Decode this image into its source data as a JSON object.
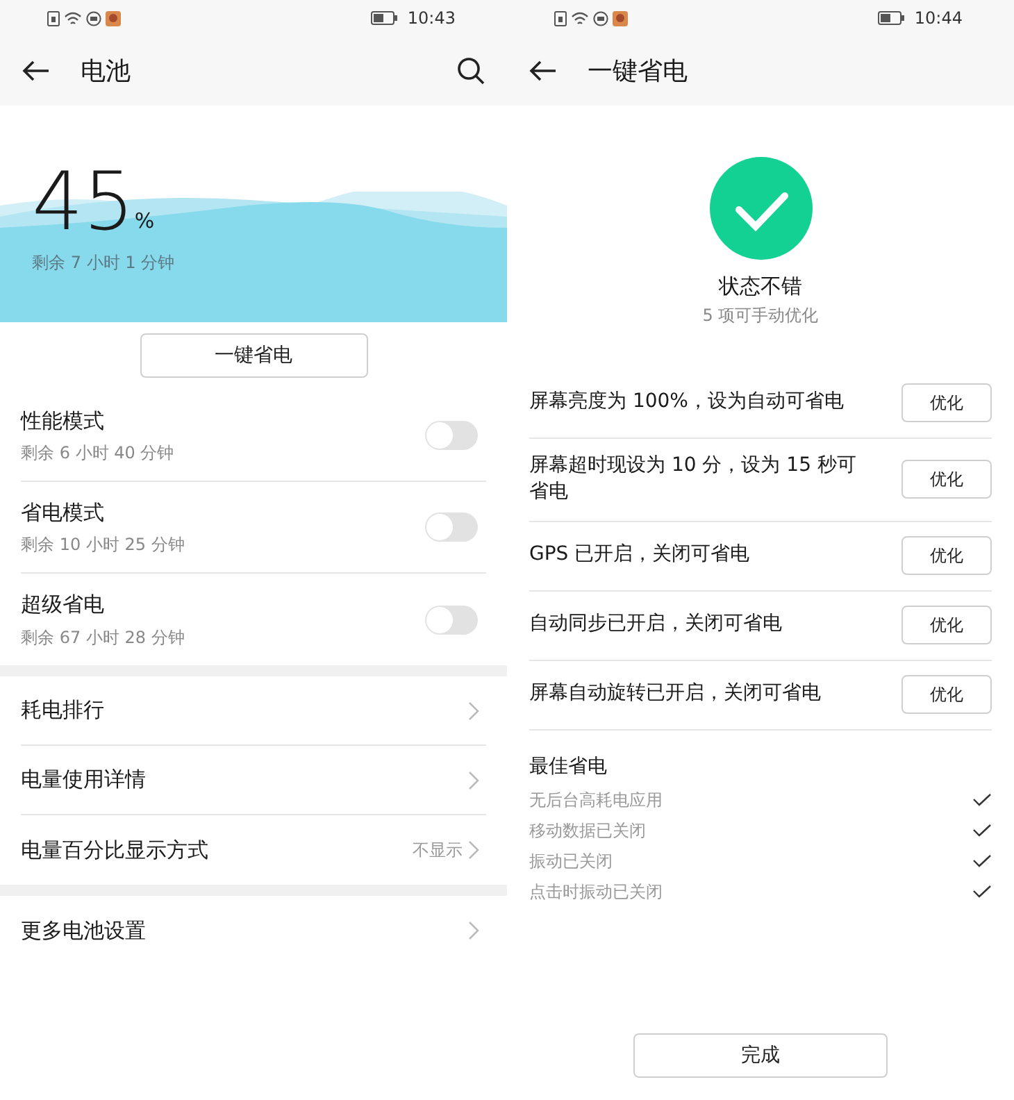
{
  "screens": [
    {
      "status_bar": {
        "time": "10:43"
      },
      "title": "电池",
      "has_search": true,
      "battery": {
        "percent": "45",
        "unit": "%",
        "remaining": "剩余 7 小时 1 分钟"
      },
      "save_button": "一键省电",
      "modes": [
        {
          "label": "性能模式",
          "sub": "剩余 6 小时 40 分钟",
          "on": false
        },
        {
          "label": "省电模式",
          "sub": "剩余 10 小时 25 分钟",
          "on": false
        },
        {
          "label": "超级省电",
          "sub": "剩余 67 小时 28 分钟",
          "on": false
        }
      ],
      "menu_groups": [
        [
          {
            "label": "耗电排行"
          },
          {
            "label": "电量使用详情"
          },
          {
            "label": "电量百分比显示方式",
            "value": "不显示"
          }
        ],
        [
          {
            "label": "更多电池设置"
          }
        ]
      ]
    },
    {
      "status_bar": {
        "time": "10:44"
      },
      "title": "一键省电",
      "has_search": false,
      "status": {
        "title": "状态不错",
        "sub": "5 项可手动优化"
      },
      "suggestions": [
        {
          "text": "屏幕亮度为 100%，设为自动可省电",
          "button": "优化"
        },
        {
          "text": "屏幕超时现设为 10 分，设为 15 秒可省电",
          "button": "优化"
        },
        {
          "text": "GPS 已开启，关闭可省电",
          "button": "优化"
        },
        {
          "text": "自动同步已开启，关闭可省电",
          "button": "优化"
        },
        {
          "text": "屏幕自动旋转已开启，关闭可省电",
          "button": "优化"
        }
      ],
      "best": {
        "title": "最佳省电",
        "items": [
          {
            "text": "无后台高耗电应用",
            "done": true
          },
          {
            "text": "移动数据已关闭",
            "done": true
          },
          {
            "text": "振动已关闭",
            "done": true
          },
          {
            "text": "点击时振动已关闭",
            "done": true
          }
        ]
      },
      "done_button": "完成"
    }
  ]
}
